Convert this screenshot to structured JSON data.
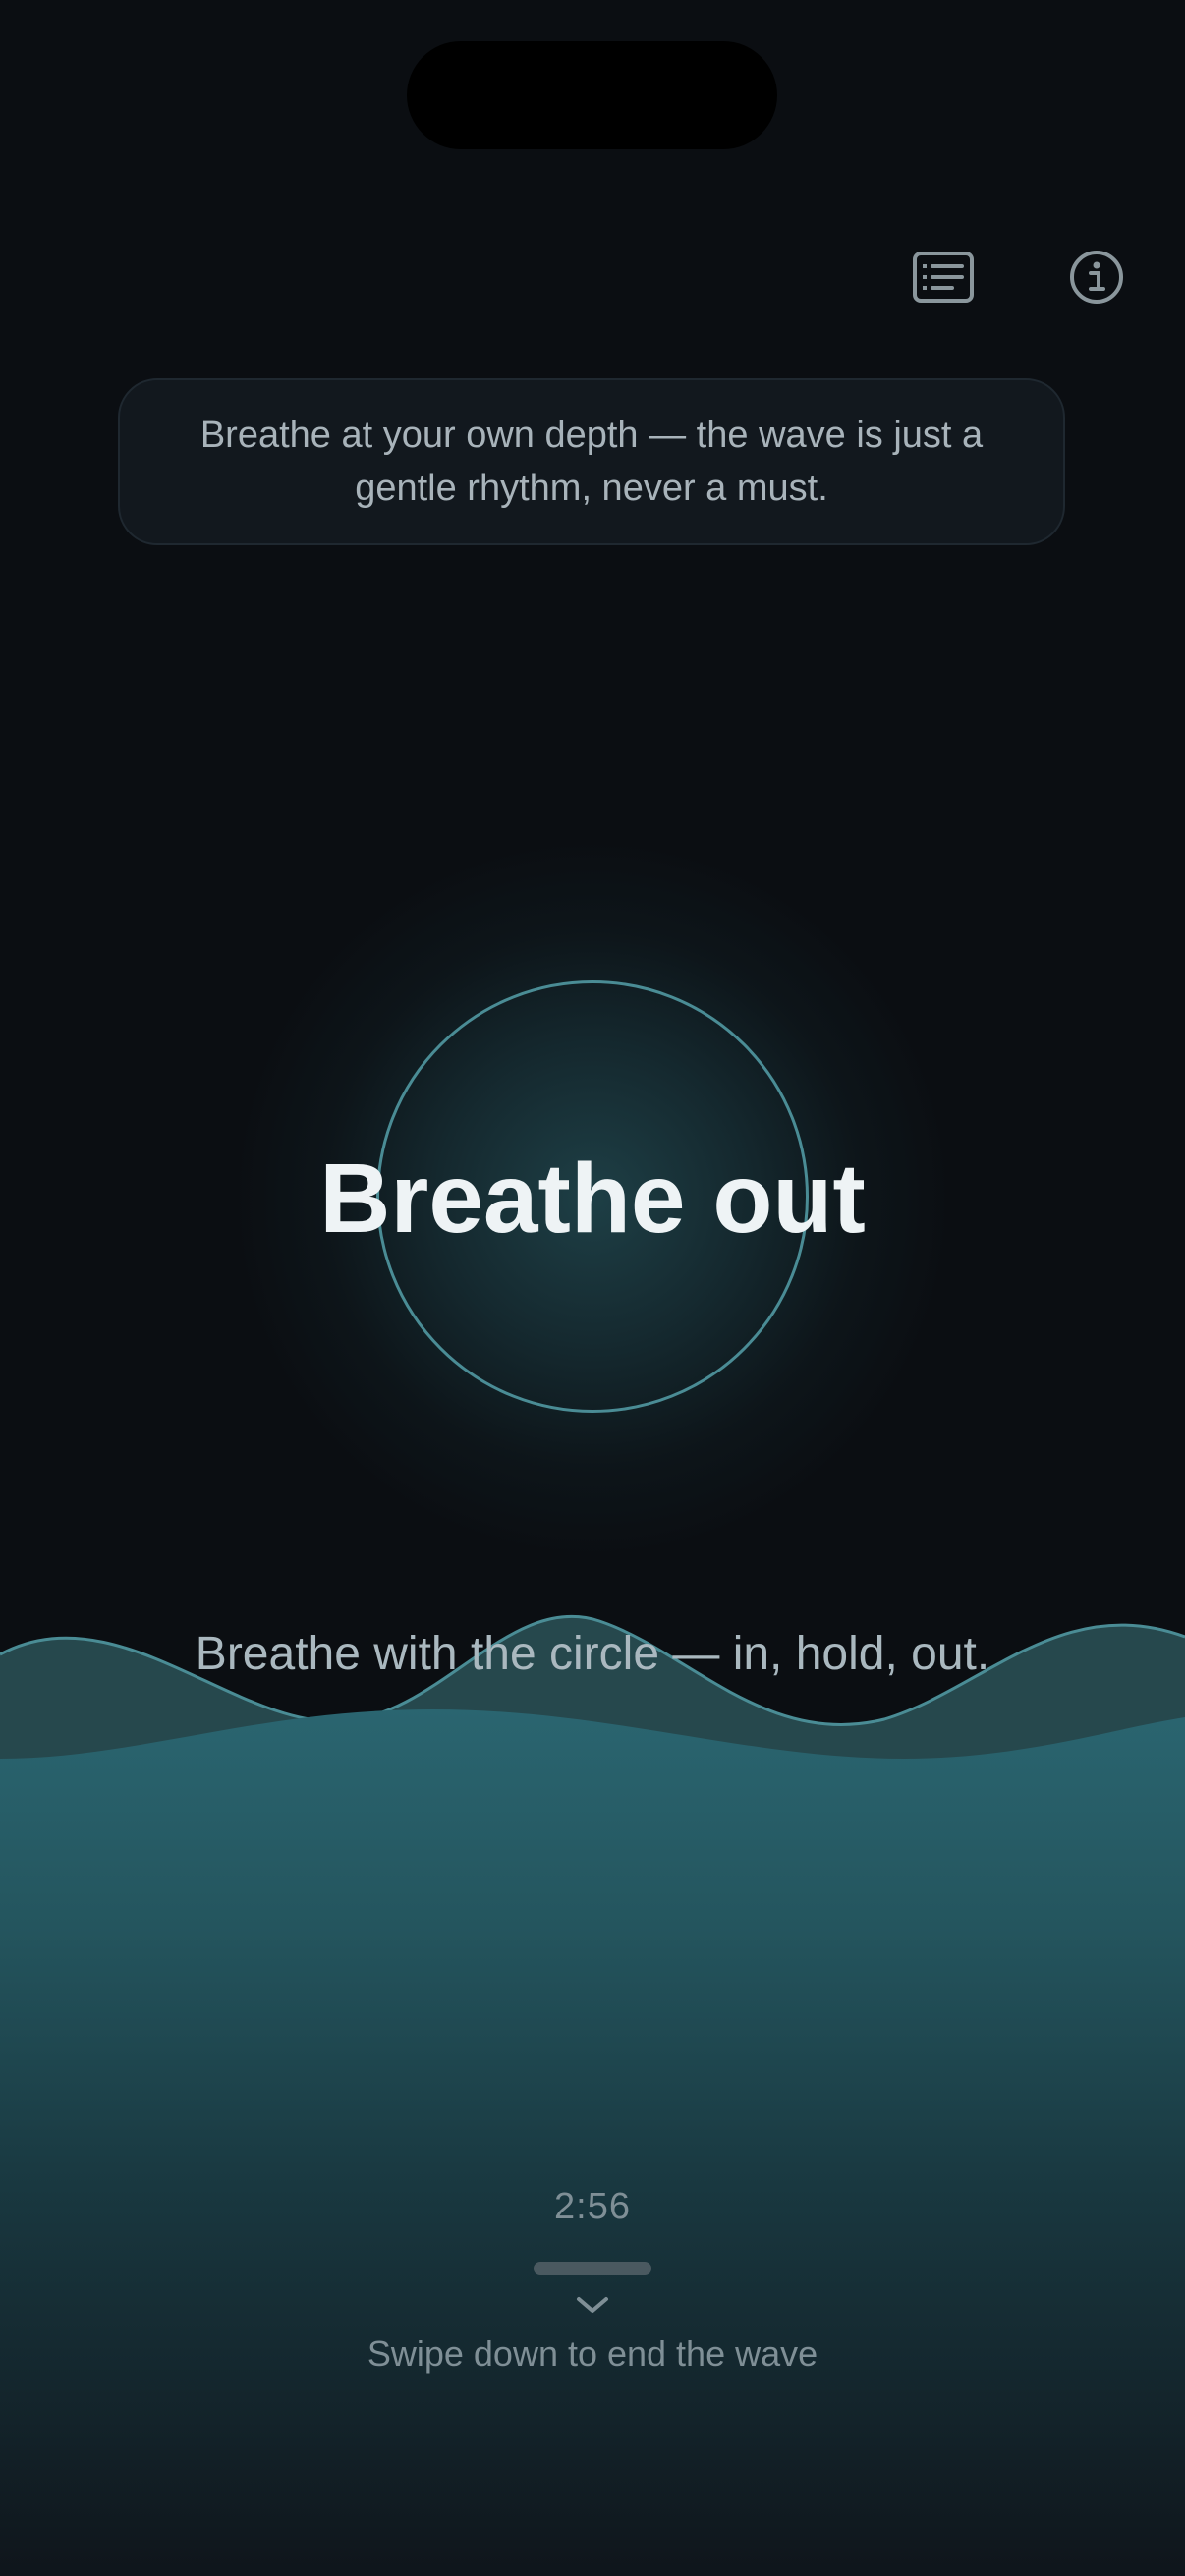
{
  "header": {
    "transcript_icon": "transcript-list-icon",
    "info_icon": "info-circle-icon"
  },
  "hint": {
    "text": "Breathe at your own depth — the wave is just a gentle rhythm, never a must."
  },
  "breath": {
    "phase": "Breathe out"
  },
  "wave": {
    "caption": "Breathe with the circle — in, hold, out."
  },
  "footer": {
    "timer": "2:56",
    "chevron_icon": "chevron-down-icon",
    "swipe_hint": "Swipe down to end the wave"
  },
  "colors": {
    "background": "#0b0e12",
    "accent": "#4a8c95",
    "wave_fill": "#28606a",
    "wave_back": "#2b5258"
  }
}
